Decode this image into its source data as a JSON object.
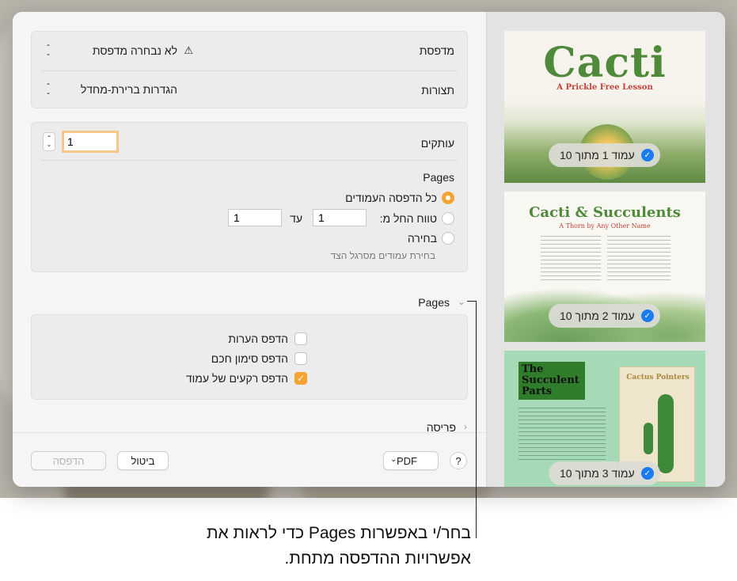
{
  "printer": {
    "label": "מדפסת",
    "value": "לא נבחרה מדפסת"
  },
  "presets": {
    "label": "תצורות",
    "value": "הגדרות ברירת-מחדל"
  },
  "copies": {
    "label": "עותקים",
    "value": "1"
  },
  "pages_section": {
    "title": "Pages",
    "all_pages": "כל הדפסה העמודים",
    "range_from_label": "טווח החל מ:",
    "range_from_value": "1",
    "range_to_label": "עד",
    "range_to_value": "1",
    "selection": "בחירה",
    "selection_hint": "בחירת עמודים מסרגל הצד"
  },
  "pages_options": {
    "header": "Pages",
    "print_comments": "הדפס הערות",
    "print_smart_annotations": "הדפס סימון חכם",
    "print_backgrounds": "הדפס רקעים של עמוד"
  },
  "layout_header": "פריסה",
  "buttons": {
    "help": "?",
    "pdf": "PDF",
    "cancel": "ביטול",
    "print": "הדפסה"
  },
  "thumbnails": [
    {
      "title": "Cacti",
      "subtitle": "A Prickle Free Lesson",
      "badge": "עמוד 1 מתוך 10"
    },
    {
      "title": "Cacti & Succulents",
      "subtitle": "A Thorn by Any Other Name",
      "badge": "עמוד 2 מתוך 10"
    },
    {
      "title": "The Succulent Parts",
      "subtitle": "Cactus Pointers",
      "badge": "עמוד 3 מתוך 10"
    }
  ],
  "callout_text": "בחר/י באפשרות Pages כדי לראות את אפשרויות ההדפסה מתחת.",
  "colors": {
    "accent": "#f6a431",
    "check_blue": "#1a7cf0",
    "cacti_green": "#4e8a3a",
    "succulent_green": "#a6d9b6"
  }
}
